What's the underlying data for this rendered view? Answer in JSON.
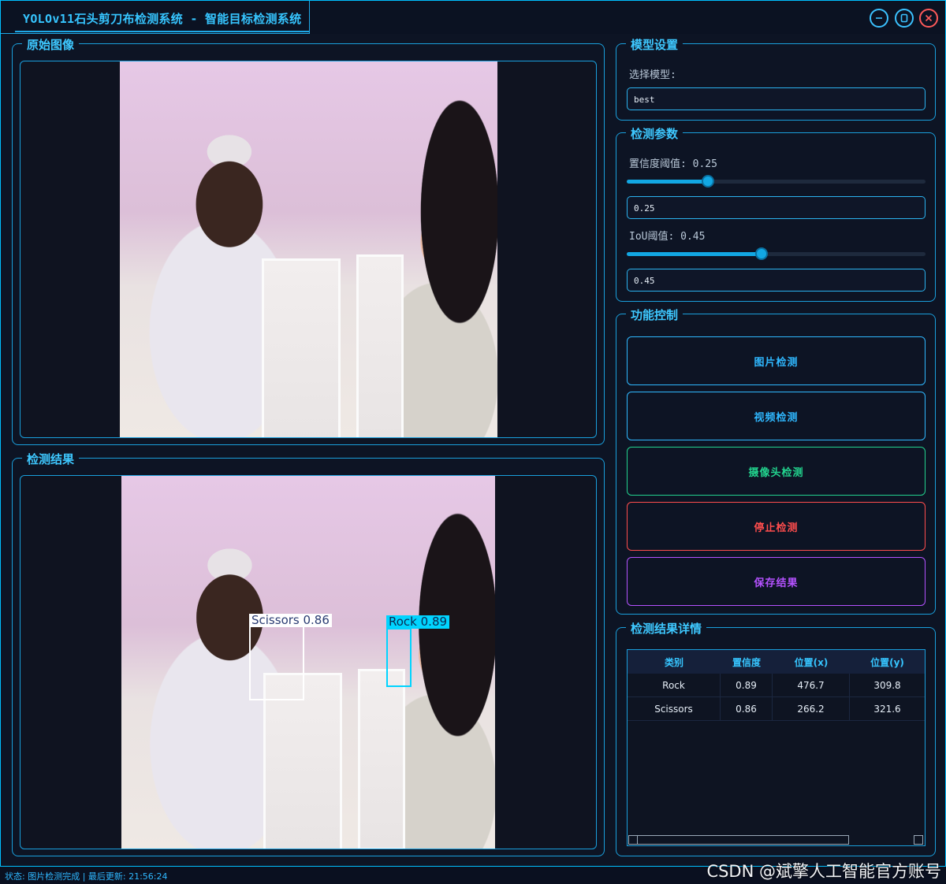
{
  "window": {
    "title": "YOLOv11石头剪刀布检测系统 - 智能目标检测系统",
    "controls": {
      "minimize": "minimize-icon",
      "maximize": "maximize-icon",
      "close": "close-icon"
    },
    "accent": "#00bfff"
  },
  "original_panel": {
    "title": "原始图像"
  },
  "result_panel": {
    "title": "检测结果",
    "detections": [
      {
        "label": "Scissors 0.86",
        "color": "#ffffff"
      },
      {
        "label": "Rock  0.89",
        "color": "#00d4ff"
      }
    ]
  },
  "model_settings": {
    "title": "模型设置",
    "select_label": "选择模型:",
    "model_value": "best"
  },
  "detection_params": {
    "title": "检测参数",
    "confidence": {
      "label": "置信度阈值: 0.25",
      "value": 0.25,
      "input": "0.25"
    },
    "iou": {
      "label": "IoU阈值: 0.45",
      "value": 0.45,
      "input": "0.45"
    }
  },
  "function_control": {
    "title": "功能控制",
    "buttons": [
      {
        "label": "图片检测",
        "color": "#2fb8ff"
      },
      {
        "label": "视频检测",
        "color": "#2fb8ff"
      },
      {
        "label": "摄像头检测",
        "color": "#22d38e"
      },
      {
        "label": "停止检测",
        "color": "#ff4d4d"
      },
      {
        "label": "保存结果",
        "color": "#b452ff"
      }
    ]
  },
  "result_details": {
    "title": "检测结果详情",
    "columns": [
      "类别",
      "置信度",
      "位置(x)",
      "位置(y)"
    ],
    "rows": [
      [
        "Rock",
        "0.89",
        "476.7",
        "309.8"
      ],
      [
        "Scissors",
        "0.86",
        "266.2",
        "321.6"
      ]
    ]
  },
  "status": {
    "text": "状态: 图片检测完成 | 最后更新: 21:56:24",
    "watermark": "CSDN @斌擎人工智能官方账号"
  }
}
